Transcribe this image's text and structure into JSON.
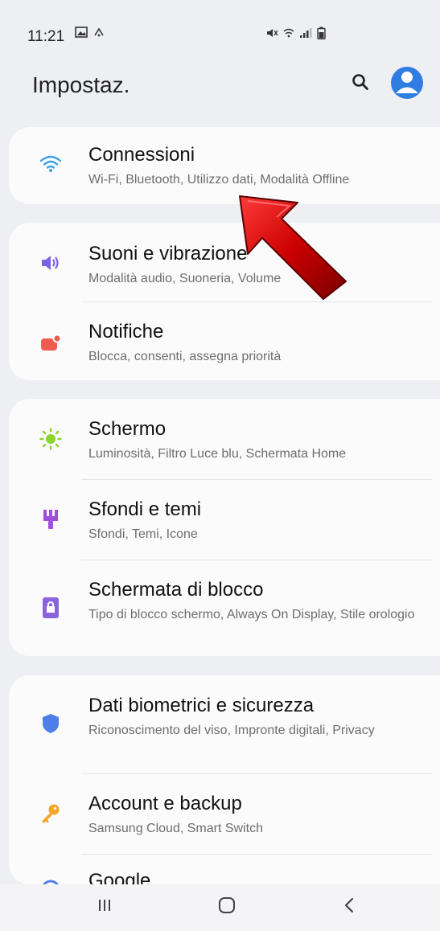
{
  "status_bar": {
    "time": "11:21",
    "icons": [
      "gallery-icon",
      "wifi-calling-icon",
      "mute-icon",
      "signal-icon",
      "battery-icon"
    ]
  },
  "header": {
    "title": "Impostaz.",
    "search_icon": "search-icon",
    "account_icon": "account-icon"
  },
  "colors": {
    "accent": "#2f7de1",
    "connessioni": "#3aa0e8",
    "suoni": "#7b62e8",
    "notifiche": "#ee5b4f",
    "schermo": "#8bd52a",
    "sfondi": "#a04fd8",
    "blocco": "#8a64dc",
    "biometrici": "#4e7fe8",
    "account": "#f5a623",
    "arrow": "#cc0000"
  },
  "settings": {
    "connessioni": {
      "title": "Connessioni",
      "subtitle": "Wi-Fi, Bluetooth, Utilizzo dati, Modalità Offline",
      "icon": "wifi-icon"
    },
    "suoni": {
      "title": "Suoni e vibrazione",
      "subtitle": "Modalità audio, Suoneria, Volume",
      "icon": "volume-icon"
    },
    "notifiche": {
      "title": "Notifiche",
      "subtitle": "Blocca, consenti, assegna priorità",
      "icon": "notification-icon"
    },
    "schermo": {
      "title": "Schermo",
      "subtitle": "Luminosità, Filtro Luce blu, Schermata Home",
      "icon": "brightness-icon"
    },
    "sfondi": {
      "title": "Sfondi e temi",
      "subtitle": "Sfondi, Temi, Icone",
      "icon": "brush-icon"
    },
    "blocco": {
      "title": "Schermata di blocco",
      "subtitle": "Tipo di blocco schermo, Always On Display, Stile orologio",
      "icon": "lock-screen-icon"
    },
    "biometrici": {
      "title": "Dati biometrici e sicurezza",
      "subtitle": "Riconoscimento del viso, Impronte digitali, Privacy",
      "icon": "shield-icon"
    },
    "account": {
      "title": "Account e backup",
      "subtitle": "Samsung Cloud, Smart Switch",
      "icon": "key-icon"
    },
    "google": {
      "title": "Google",
      "icon": "google-icon"
    }
  },
  "nav_bar": {
    "recents_icon": "recents-icon",
    "home_icon": "home-icon",
    "back_icon": "back-icon"
  },
  "annotation": {
    "icon": "red-arrow-icon"
  }
}
